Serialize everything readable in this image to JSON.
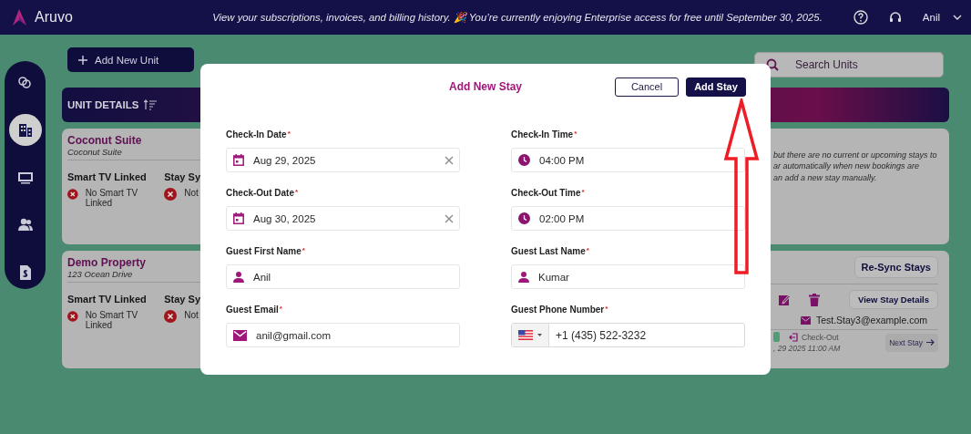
{
  "header": {
    "brand": "Aruvo",
    "notice": "View your subscriptions, invoices, and billing history. 🎉 You’re currently enjoying Enterprise access for free until September 30, 2025.",
    "user": "Anil"
  },
  "sidebar": {
    "items": [
      {
        "selected": false
      },
      {
        "selected": true
      },
      {
        "selected": false
      },
      {
        "selected": false
      },
      {
        "selected": false
      }
    ]
  },
  "toolbar": {
    "add_button": "Add New Unit",
    "search_placeholder": "Search Units"
  },
  "unit_details": {
    "title": "UNIT DETAILS"
  },
  "units": [
    {
      "name": "Coconut Suite",
      "subtitle": "Coconut Suite",
      "tv_heading": "Smart TV Linked",
      "tv_status": "No Smart TV Linked",
      "sync_heading": "Stay Sy",
      "sync_status": "Not",
      "note_lines": [
        "but there are no current or upcoming stays to",
        "ar automatically when new bookings are",
        "an add a new stay manually."
      ]
    },
    {
      "name": "Demo Property",
      "subtitle": "123 Ocean Drive",
      "tv_heading": "Smart TV Linked",
      "tv_status": "No Smart TV Linked",
      "sync_heading": "Stay Sy",
      "sync_status": "Not",
      "resync_button": "Re-Sync Stays",
      "view_button": "View Stay Details",
      "guest_email": "Test.Stay3@example.com",
      "checkout_label": "Check-Out",
      "checkout_time": ", 29 2025 11:00 AM",
      "next_button": "Next Stay"
    }
  ],
  "modal": {
    "title": "Add New Stay",
    "cancel": "Cancel",
    "submit": "Add Stay",
    "fields": [
      {
        "kind": "date",
        "label": "Check-In Date",
        "required_mark": "*",
        "value": "Aug 29, 2025"
      },
      {
        "kind": "time",
        "label": "Check-In Time",
        "required_mark": "*",
        "value": "04:00 PM"
      },
      {
        "kind": "date",
        "label": "Check-Out Date",
        "required_mark": "*",
        "value": "Aug 30, 2025"
      },
      {
        "kind": "time",
        "label": "Check-Out Time",
        "required_mark": "*",
        "value": "02:00 PM"
      },
      {
        "kind": "name",
        "label": "Guest First Name",
        "required_mark": "*",
        "value": "Anil"
      },
      {
        "kind": "name",
        "label": "Guest Last Name",
        "required_mark": "*",
        "value": "Kumar"
      },
      {
        "kind": "email",
        "label": "Guest Email",
        "required_mark": "*",
        "value": "anil@gmail.com"
      },
      {
        "kind": "phone",
        "label": "Guest Phone Number",
        "required_mark": "*",
        "value": "+1 (435) 522-3232"
      }
    ]
  }
}
